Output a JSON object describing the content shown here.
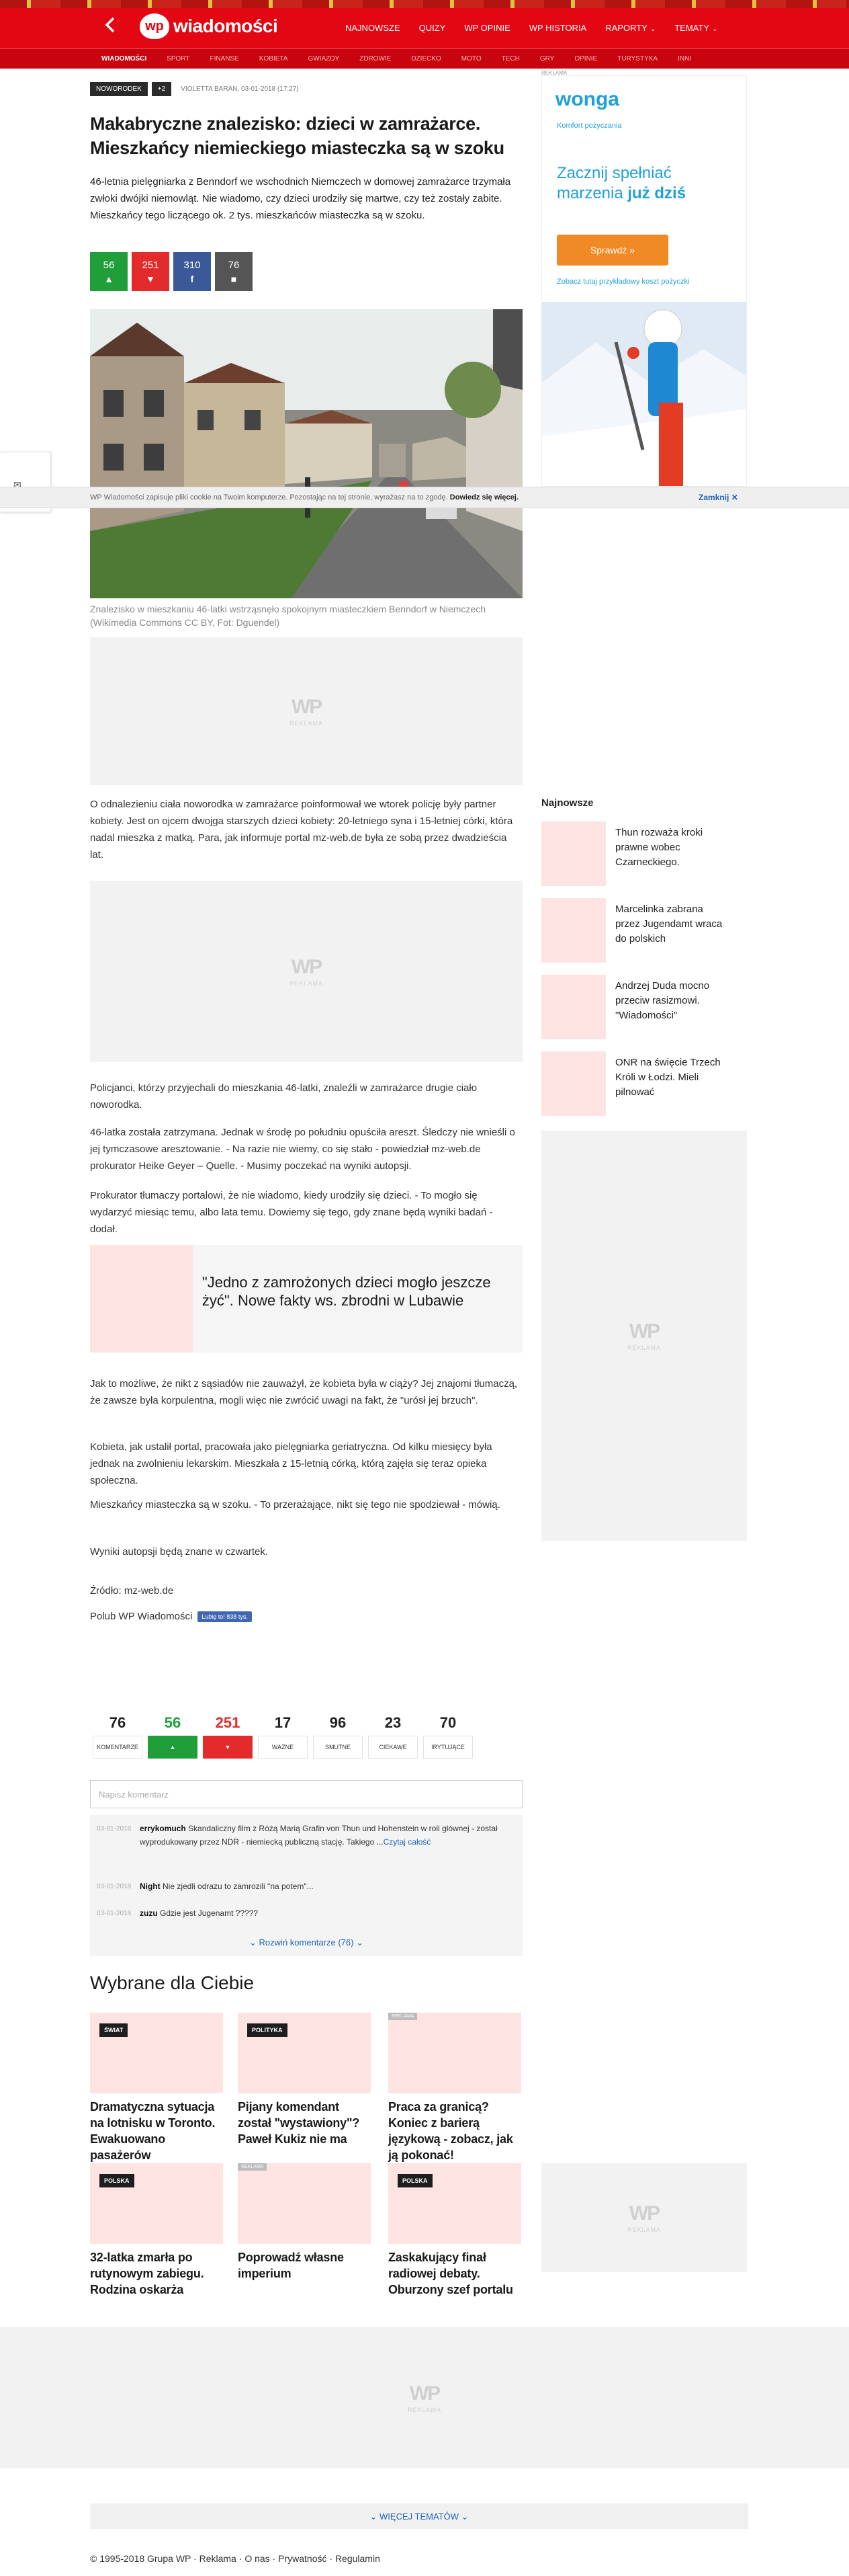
{
  "header": {
    "logo_letters": "wp",
    "logo_name": "wiadomości",
    "nav": [
      "NAJNOWSZE",
      "QUIZY",
      "WP OPINIE",
      "WP HISTORIA",
      "RAPORTY",
      "TEMATY"
    ],
    "subnav": [
      "WIADOMOŚCI",
      "SPORT",
      "FINANSE",
      "KOBIETA",
      "GWIAZDY",
      "ZDROWIE",
      "DZIECKO",
      "MOTO",
      "TECH",
      "GRY",
      "OPINIE",
      "TURYSTYKA",
      "INNI"
    ]
  },
  "article": {
    "tag": "NOWORODEK",
    "tag_more": "+2",
    "byline": "VIOLETTA BARAN, 03-01-2018 (17:27)",
    "title": "Makabryczne znalezisko: dzieci w zamrażarce. Mieszkańcy niemieckiego miasteczka są w szoku",
    "lead": "46-letnia pielęgniarka z Benndorf we wschodnich Niemczech w domowej zamrażarce trzymała zwłoki dwójki niemowląt. Nie wiadomo, czy dzieci urodziły się martwe, czy też zostały zabite. Mieszkańcy tego liczącego ok. 2 tys. mieszkańców miasteczka są w szoku.",
    "reactions": [
      {
        "count": "56",
        "icon": "thumbs-up-icon",
        "color": "#1f9e3a"
      },
      {
        "count": "251",
        "icon": "thumbs-down-icon",
        "color": "#e32b2b"
      },
      {
        "count": "310",
        "icon": "facebook-icon",
        "color": "#3b5998"
      },
      {
        "count": "76",
        "icon": "comment-icon",
        "color": "#555555"
      }
    ],
    "caption": "Znalezisko w mieszkaniu 46-latki wstrząsnęło spokojnym miasteczkiem Benndorf w Niemczech (Wikimedia Commons CC BY, Fot: Dguendel)",
    "ad_label": "REKLAMA",
    "paragraphs": [
      "O odnalezieniu ciała noworodka w zamrażarce poinformował we wtorek policję były partner kobiety. Jest on ojcem dwojga starszych dzieci kobiety: 20-letniego syna i 15-letniej córki, która nadal mieszka z matką. Para, jak informuje portal mz-web.de była ze sobą przez dwadzieścia lat.",
      "Policjanci, którzy przyjechali do mieszkania 46-latki, znaleźli w zamrażarce drugie ciało noworodka.",
      "46-latka została zatrzymana. Jednak w środę po południu opuściła areszt. Śledczy nie wnieśli o jej tymczasowe aresztowanie. - Na razie nie wiemy, co się stało - powiedział mz-web.de prokurator Heike Geyer – Quelle. - Musimy poczekać na wyniki autopsji.",
      "Prokurator tłumaczy portalowi, że nie wiadomo, kiedy urodziły się dzieci. - To mogło się wydarzyć miesiąc temu, albo lata temu. Dowiemy się tego, gdy znane będą wyniki badań - dodał.",
      "Jak to możliwe, że nikt z sąsiadów nie zauważył, że kobieta była w ciąży? Jej znajomi tłumaczą, że zawsze była korpulentna, mogli więc nie zwrócić uwagi na fakt, że \"urósł jej brzuch\".",
      "Kobieta, jak ustalił portal, pracowała jako pielęgniarka geriatryczna. Od kilku miesięcy była jednak na zwolnieniu lekarskim. Mieszkała z 15-letnią córką, którą zajęła się teraz opieka społeczna.",
      "Mieszkańcy miasteczka są w szoku. - To przerażające, nikt się tego nie spodziewał - mówią.",
      "Wyniki autopsji będą znane w czwartek."
    ],
    "quote": "\"Jedno z zamrożonych dzieci mogło jeszcze żyć\". Nowe fakty ws. zbrodni w Lubawie",
    "source": "Źródło: mz-web.de",
    "like_label": "Polub WP Wiadomości",
    "like_button": "Lubię to! 838 tys."
  },
  "sidebar": {
    "ad_label": "REKLAMA",
    "wonga": {
      "brand": "wonga",
      "tagline": "Komfort pożyczania",
      "headline_1": "Zacznij spełniać",
      "headline_2": "marzenia ",
      "headline_bold": "już dziś",
      "cta": "Sprawdź »",
      "note": "Zobacz tutaj przykładowy koszt pożyczki"
    },
    "najnowsze_title": "Najnowsze",
    "najnowsze": [
      "Thun rozważa kroki prawne wobec Czarneckiego.",
      "Marcelinka zabrana przez Jugendamt wraca do polskich",
      "Andrzej Duda mocno przeciw rasizmowi. \"Wiadomości\"",
      "ONR na święcie Trzech Króli w Łodzi. Mieli pilnować"
    ]
  },
  "cookie": {
    "text": "WP Wiadomości zapisuje pliki cookie na Twoim komputerze. Pozostając na tej stronie, wyrażasz na to zgodę. ",
    "link": "Dowiedz się więcej.",
    "close": "Zamknij"
  },
  "reaction_counts": [
    {
      "n": "76",
      "label": "KOMENTARZE",
      "color": "#222222"
    },
    {
      "n": "56",
      "label": "",
      "color": "#1f9e3a"
    },
    {
      "n": "251",
      "label": "",
      "color": "#e32b2b"
    },
    {
      "n": "17",
      "label": "WAŻNE",
      "color": "#222222"
    },
    {
      "n": "96",
      "label": "SMUTNE",
      "color": "#222222"
    },
    {
      "n": "23",
      "label": "CIEKAWE",
      "color": "#222222"
    },
    {
      "n": "70",
      "label": "IRYTUJĄCE",
      "color": "#222222"
    }
  ],
  "comments": {
    "placeholder": "Napisz komentarz",
    "items": [
      {
        "date": "03-01-2018",
        "user": "errykomuch",
        "text": "Skandaliczny film z Różą Marią Grafin von Thun und Hohenstein w roli głównej - został wyprodukowany przez NDR - niemiecką publiczną stację. Takiego ...",
        "more": "Czytaj całość"
      },
      {
        "date": "03-01-2018",
        "user": "Night",
        "text": "Nie zjedli odrazu to zamrozili \"na potem\"...",
        "more": ""
      },
      {
        "date": "03-01-2018",
        "user": "zuzu",
        "text": "Gdzie jest Jugenamt ?????",
        "more": ""
      }
    ],
    "expand": "Rozwiń komentarze (76)"
  },
  "recommended": {
    "title": "Wybrane dla Ciebie",
    "cards": [
      {
        "badge": "ŚWIAT",
        "title": "Dramatyczna sytuacja na lotnisku w Toronto. Ewakuowano pasażerów"
      },
      {
        "badge": "POLITYKA",
        "title": "Pijany komendant został \"wystawiony\"? Paweł Kukiz nie ma"
      },
      {
        "badge": "REKLAMA",
        "title": "Praca za granicą? Koniec z barierą językową - zobacz, jak ją pokonać!"
      },
      {
        "badge": "POLSKA",
        "title": "32-latka zmarła po rutynowym zabiegu. Rodzina oskarża"
      },
      {
        "badge": "REKLAMA",
        "title": "Poprowadź własne imperium"
      },
      {
        "badge": "POLSKA",
        "title": "Zaskakujący finał radiowej debaty. Oburzony szef portalu"
      }
    ]
  },
  "footer": {
    "more_topics": "WIĘCEJ TEMATÓW",
    "copyright": "© 1995-2018 Grupa WP",
    "links": [
      "Reklama",
      "O nas",
      "Prywatność",
      "Regulamin"
    ]
  }
}
